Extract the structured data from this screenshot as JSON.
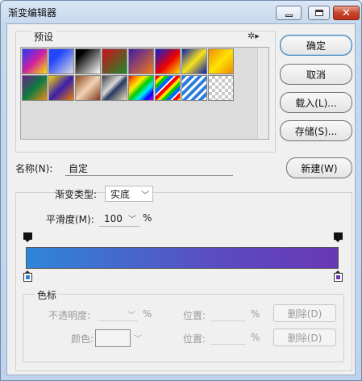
{
  "window": {
    "title": "渐变编辑器"
  },
  "presets": {
    "label": "预设",
    "gear": "✲▸",
    "swatches": [
      {
        "name": "swatch-blue-red-yellow",
        "bg": "linear-gradient(135deg,#1e3cff,#d11fa1 50%,#f6e600)"
      },
      {
        "name": "swatch-blue-transparent",
        "bg": "linear-gradient(135deg,#2146ff 30%,rgba(255,255,255,0))"
      },
      {
        "name": "swatch-black-white",
        "bg": "linear-gradient(135deg,#000 20%,#fff)"
      },
      {
        "name": "swatch-red-green",
        "bg": "linear-gradient(135deg,#d0101c,#1b8a2a)"
      },
      {
        "name": "swatch-violet-orange",
        "bg": "linear-gradient(135deg,#3f1aa8,#f37a1c)"
      },
      {
        "name": "swatch-blue-red-yellow-2",
        "bg": "linear-gradient(135deg,#0b1fd9,#e00 55%,#f9e000)"
      },
      {
        "name": "swatch-blue-yellow-blue",
        "bg": "linear-gradient(135deg,#091ab5,#f7e31a 50%,#091ab5)"
      },
      {
        "name": "swatch-orange-yellow",
        "bg": "linear-gradient(135deg,#f08a00,#ffe300 50%,#f08a00)"
      },
      {
        "name": "swatch-violet-green-orange",
        "bg": "linear-gradient(135deg,#6b1d8a,#0d7c3f 50%,#f28a14)"
      },
      {
        "name": "swatch-yellow-violet-orange",
        "bg": "linear-gradient(135deg,#f6d700,#3a1fae 50%,#f07d00)"
      },
      {
        "name": "swatch-copper",
        "bg": "linear-gradient(135deg,#8a4a22,#f4d2b5 50%,#7e3b17)"
      },
      {
        "name": "swatch-chrome",
        "bg": "linear-gradient(135deg,#3d3d3d,#d9d9d9 40%,#283a60 55%,#f2e1b8)"
      },
      {
        "name": "swatch-spectrum",
        "bg": "linear-gradient(135deg,#e00,#f80,#fe0,#0c0,#0ef,#00f,#c0f)"
      },
      {
        "name": "swatch-transparent-rainbow",
        "bg": "repeating-linear-gradient(135deg,#f00 0 4px,#fd0 4px 8px,#0c0 8px 12px,#06f 12px 16px,#fff 16px 18px)"
      },
      {
        "name": "swatch-transparent-stripes",
        "bg": "repeating-linear-gradient(135deg,#2a7de0 0 4px,#fff 4px 7px)"
      },
      {
        "name": "swatch-neutral-density",
        "bg": "repeating-conic-gradient(#c8c8c8 0 25%,#fff 0 50%) 0 0/8px 8px"
      }
    ]
  },
  "buttons": {
    "ok": "确定",
    "cancel": "取消",
    "load": "载入(L)...",
    "save": "存储(S)...",
    "new": "新建(W)",
    "delete_opacity": "删除(D)",
    "delete_color": "删除(D)"
  },
  "name_field": {
    "label": "名称(N):",
    "value": "自定"
  },
  "gradient": {
    "type_label": "渐变类型:",
    "type_value": "实底",
    "smoothness_label": "平滑度(M):",
    "smoothness_value": "100",
    "smoothness_unit": "%",
    "start_color": "#2f86d8",
    "end_color": "#6a37b5"
  },
  "stops": {
    "group_label": "色标",
    "opacity_label": "不透明度:",
    "opacity_unit": "%",
    "location_label_1": "位置:",
    "location_unit_1": "%",
    "color_label": "颜色:",
    "location_label_2": "位置:",
    "location_unit_2": "%"
  }
}
